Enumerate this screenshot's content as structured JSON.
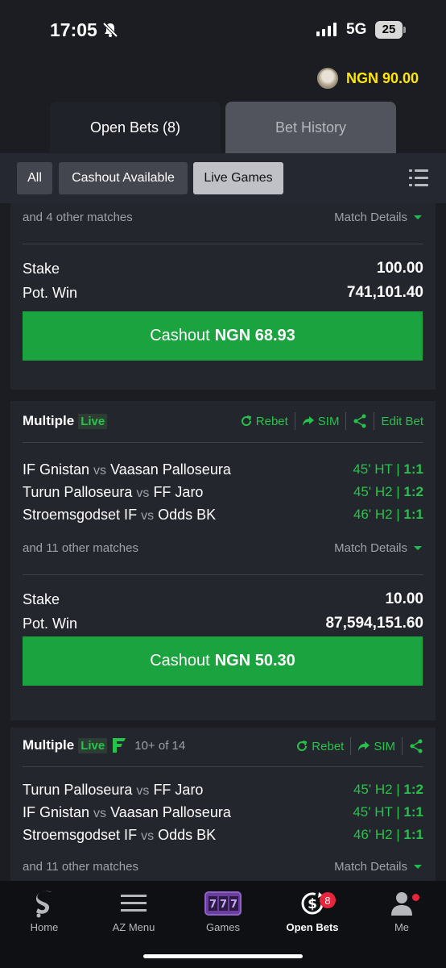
{
  "status_bar": {
    "time": "17:05",
    "network": "5G",
    "battery": "25"
  },
  "header": {
    "balance": "NGN 90.00"
  },
  "tabs": [
    {
      "label": "Open Bets (8)",
      "active": true
    },
    {
      "label": "Bet History",
      "active": false
    }
  ],
  "filters": [
    {
      "label": "All"
    },
    {
      "label": "Cashout Available"
    },
    {
      "label": "Live Games",
      "active": true
    }
  ],
  "bets": [
    {
      "other_matches": "and 4 other matches",
      "match_details": "Match Details",
      "stake_label": "Stake",
      "stake": "100.00",
      "potwin_label": "Pot. Win",
      "potwin": "741,101.40",
      "cashout_prefix": "Cashout",
      "cashout_amount": "NGN 68.93"
    },
    {
      "type": "Multiple",
      "live": "Live",
      "actions": {
        "rebet": "Rebet",
        "sim": "SIM",
        "edit": "Edit Bet"
      },
      "matches": [
        {
          "home": "IF Gnistan",
          "vs": "vs",
          "away": "Vaasan Palloseura",
          "time": "45' HT |",
          "score": "1:1"
        },
        {
          "home": "Turun Palloseura",
          "vs": "vs",
          "away": "FF Jaro",
          "time": "45' H2 |",
          "score": "1:2"
        },
        {
          "home": "Stroemsgodset IF",
          "vs": "vs",
          "away": "Odds BK",
          "time": "46' H2 |",
          "score": "1:1"
        }
      ],
      "other_matches": "and 11 other matches",
      "match_details": "Match Details",
      "stake_label": "Stake",
      "stake": "10.00",
      "potwin_label": "Pot. Win",
      "potwin": "87,594,151.60",
      "cashout_prefix": "Cashout",
      "cashout_amount": "NGN 50.30"
    },
    {
      "type": "Multiple",
      "live": "Live",
      "sub": "10+ of 14",
      "actions": {
        "rebet": "Rebet",
        "sim": "SIM"
      },
      "matches": [
        {
          "home": "Turun Palloseura",
          "vs": "vs",
          "away": "FF Jaro",
          "time": "45' H2 |",
          "score": "1:2"
        },
        {
          "home": "IF Gnistan",
          "vs": "vs",
          "away": "Vaasan Palloseura",
          "time": "45' HT |",
          "score": "1:1"
        },
        {
          "home": "Stroemsgodset IF",
          "vs": "vs",
          "away": "Odds BK",
          "time": "46' H2 |",
          "score": "1:1"
        }
      ],
      "other_matches": "and 11 other matches",
      "match_details": "Match Details"
    }
  ],
  "bottom_nav": [
    {
      "label": "Home",
      "icon": "sporty-logo-icon"
    },
    {
      "label": "AZ Menu",
      "icon": "menu-icon"
    },
    {
      "label": "Games",
      "icon": "slot-machine-icon"
    },
    {
      "label": "Open Bets",
      "icon": "open-bets-icon",
      "badge": "8",
      "active": true
    },
    {
      "label": "Me",
      "icon": "user-icon"
    }
  ],
  "colors": {
    "accent_green": "#1aa33e",
    "balance_yellow": "#ffe600",
    "badge_red": "#e8253a"
  }
}
